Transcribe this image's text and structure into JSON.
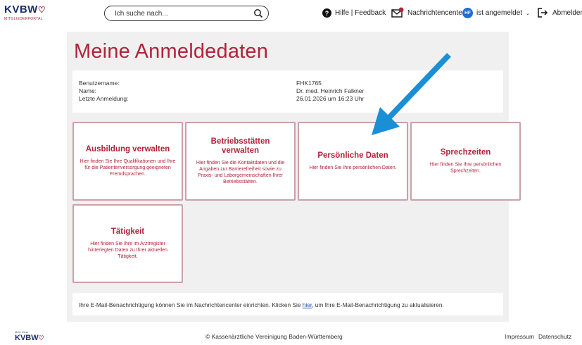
{
  "header": {
    "logo_main": "KVBW",
    "logo_sub": "MITGLIEDERPORTAL",
    "search_placeholder": "Ich suche nach...",
    "help_label": "Hilfe | Feedback",
    "messages_label": "Nachrichtencenter",
    "avatar_initials": "HF",
    "user_label": "ist angemeldet",
    "logout_label": "Abmelden"
  },
  "page": {
    "title": "Meine Anmeldedaten"
  },
  "info": {
    "username_label": "Benutzername:",
    "name_label": "Name:",
    "last_login_label": "Letzte Anmeldung:",
    "username_value": "FHK1765",
    "name_value": "Dr. med. Heinrich Falkner",
    "last_login_value": "26.01.2026 um 16:23 Uhr"
  },
  "cards": [
    {
      "title": "Ausbildung verwalten",
      "desc": "Hier finden Sie Ihre Qualifikationen und Ihre für die Patientenversorgung geeigneten Fremdsprachen."
    },
    {
      "title": "Betriebsstätten verwalten",
      "desc": "Hier finden Sie die Kontaktdaten und die Angaben zur Barrierefreiheit sowie zu Praxis- und Laborgemeinschaften Ihrer Betriebsstätten."
    },
    {
      "title": "Persönliche Daten",
      "desc": "Hier finden Sie Ihre persönlichen Daten."
    },
    {
      "title": "Sprechzeiten",
      "desc": "Hier finden Sie Ihre persönlichen Sprechzeiten."
    },
    {
      "title": "Tätigkeit",
      "desc": "Hier finden Sie Ihre im Arztregister hinterlegten Daten zu Ihrer aktuellen Tätigkeit."
    }
  ],
  "notice": {
    "before": "Ihre E-Mail-Benachrichtigung können Sie im Nachrichtencenter einrichten. Klicken Sie ",
    "link": "hier",
    "after": ", um Ihre E-Mail-Benachrichtigung zu aktualisieren."
  },
  "footer": {
    "logo_small": "Mein Gesu",
    "logo_main": "KVBW",
    "copyright": "© Kassenärztliche Vereinigung Baden-Württemberg",
    "impressum": "Impressum",
    "datenschutz": "Datenschutz"
  },
  "colors": {
    "brand_red": "#b0233a",
    "brand_blue": "#1b2f6b",
    "arrow_blue": "#1a8fd6",
    "avatar_blue": "#1f6fd0"
  }
}
